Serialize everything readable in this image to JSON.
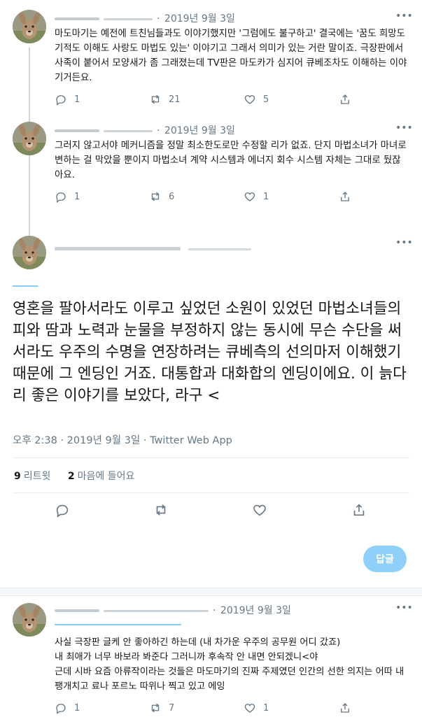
{
  "tweets": [
    {
      "date": "2019년 9월 3일",
      "text": "마도마기는 예전에 트친님들과도 이야기했지만 '그럼에도 불구하고' 결국에는 '꿈도 희망도 기적도 이해도 사랑도 마법도 있는' 이야기고 그래서 의미가 있는 거란 말이죠. 극장판에서 사족이 붙어서 모양새가 좀 그래졌는데 TV판은 마도카가 심지어 큐베조차도 이해하는 이야기거든요.",
      "replies": "1",
      "retweets": "21",
      "likes": "5"
    },
    {
      "date": "2019년 9월 3일",
      "text": "그러지 않고서야 메커니즘을 정말 최소한도로만 수정할 리가 없죠. 단지 마법소녀가 마녀로 변하는 걸 막았을 뿐이지 마법소녀 계약 시스템과 에너지 회수 시스템 자체는 그대로 뒀잖아요.",
      "replies": "1",
      "retweets": "6",
      "likes": "1"
    }
  ],
  "main_tweet": {
    "text": "영혼을 팔아서라도 이루고 싶었던 소원이 있었던 마법소녀들의 피와 땀과 노력과 눈물을 부정하지 않는 동시에 무슨 수단을 써서라도 우주의 수명을 연장하려는 큐베측의 선의마저 이해했기 때문에 그 엔딩인 거죠. 대통합과 대화합의 엔딩이에요. 이 늙다리 좋은 이야기를 보았다, 라구 <",
    "meta": "오후 2:38 · 2019년 9월 3일 · Twitter Web App",
    "retweet_count": "9",
    "retweet_label": "리트윗",
    "like_count": "2",
    "like_label": "마음에 들어요"
  },
  "reply_button_label": "답글",
  "reply_tweet": {
    "date": "2019년 9월 3일",
    "text": "사실 극장판 글케 안 좋아하긴 하는데 (내 차가운 우주의 공무원 어디 갔죠)\n내 최애가 너무 바보라 봐준다 그러니까 후속작 안 내면 안되겠니<야\n근데 시바 요즘 아류작이라는 것들은 마도마기의 진짜 주제였던 인간의 선한 의지는 어따 내팽개치고 료나 포르노 따위나 찍고 있고 에잉",
    "replies": "1",
    "retweets": "7",
    "likes": "1"
  },
  "icons": {
    "reply": "reply-icon",
    "retweet": "retweet-icon",
    "like": "heart-icon",
    "share": "share-icon",
    "more": "more-icon"
  },
  "colors": {
    "accent": "#1da1f2",
    "reply_button": "#8ed0f9",
    "muted": "#657786"
  }
}
